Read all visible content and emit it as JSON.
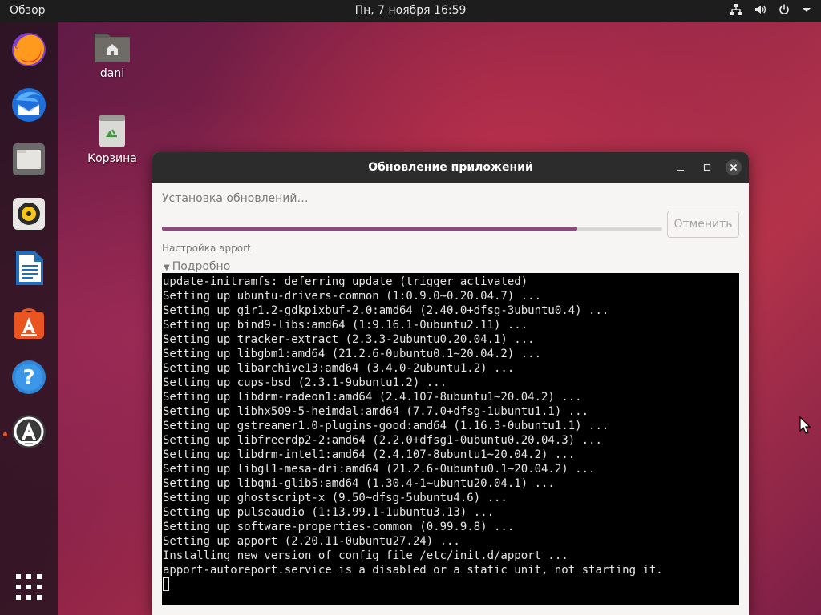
{
  "topbar": {
    "activities": "Обзор",
    "clock": "Пн, 7 ноября  16:59",
    "tray_icons": [
      "network-icon",
      "volume-icon",
      "power-icon",
      "menu-arrow-icon"
    ]
  },
  "dock": {
    "items": [
      "firefox",
      "thunderbird",
      "files",
      "rhythmbox",
      "libreoffice-writer",
      "ubuntu-software",
      "help",
      "software-updater"
    ],
    "show_apps": "show-applications-icon"
  },
  "desktop": {
    "home_label": "dani",
    "trash_label": "Корзина"
  },
  "window": {
    "title": "Обновление приложений",
    "status": "Установка обновлений…",
    "progress": 0.83,
    "cancel_label": "Отменить",
    "substatus": "Настройка apport",
    "details_label": "Подробно",
    "terminal_lines": [
      "update-initramfs: deferring update (trigger activated)",
      "Setting up ubuntu-drivers-common (1:0.9.0~0.20.04.7) ...",
      "Setting up gir1.2-gdkpixbuf-2.0:amd64 (2.40.0+dfsg-3ubuntu0.4) ...",
      "Setting up bind9-libs:amd64 (1:9.16.1-0ubuntu2.11) ...",
      "Setting up tracker-extract (2.3.3-2ubuntu0.20.04.1) ...",
      "Setting up libgbm1:amd64 (21.2.6-0ubuntu0.1~20.04.2) ...",
      "Setting up libarchive13:amd64 (3.4.0-2ubuntu1.2) ...",
      "Setting up cups-bsd (2.3.1-9ubuntu1.2) ...",
      "Setting up libdrm-radeon1:amd64 (2.4.107-8ubuntu1~20.04.2) ...",
      "Setting up libhx509-5-heimdal:amd64 (7.7.0+dfsg-1ubuntu1.1) ...",
      "Setting up gstreamer1.0-plugins-good:amd64 (1.16.3-0ubuntu1.1) ...",
      "Setting up libfreerdp2-2:amd64 (2.2.0+dfsg1-0ubuntu0.20.04.3) ...",
      "Setting up libdrm-intel1:amd64 (2.4.107-8ubuntu1~20.04.2) ...",
      "Setting up libgl1-mesa-dri:amd64 (21.2.6-0ubuntu0.1~20.04.2) ...",
      "Setting up libqmi-glib5:amd64 (1.30.4-1~ubuntu20.04.1) ...",
      "Setting up ghostscript-x (9.50~dfsg-5ubuntu4.6) ...",
      "Setting up pulseaudio (1:13.99.1-1ubuntu3.13) ...",
      "Setting up software-properties-common (0.99.9.8) ...",
      "Setting up apport (2.20.11-0ubuntu27.24) ...",
      "Installing new version of config file /etc/init.d/apport ...",
      "apport-autoreport.service is a disabled or a static unit, not starting it."
    ]
  },
  "colors": {
    "accent": "#e95420",
    "progress": "#8a4b7c",
    "titlebar": "#2c2c2c",
    "terminal_bg": "#000000"
  }
}
